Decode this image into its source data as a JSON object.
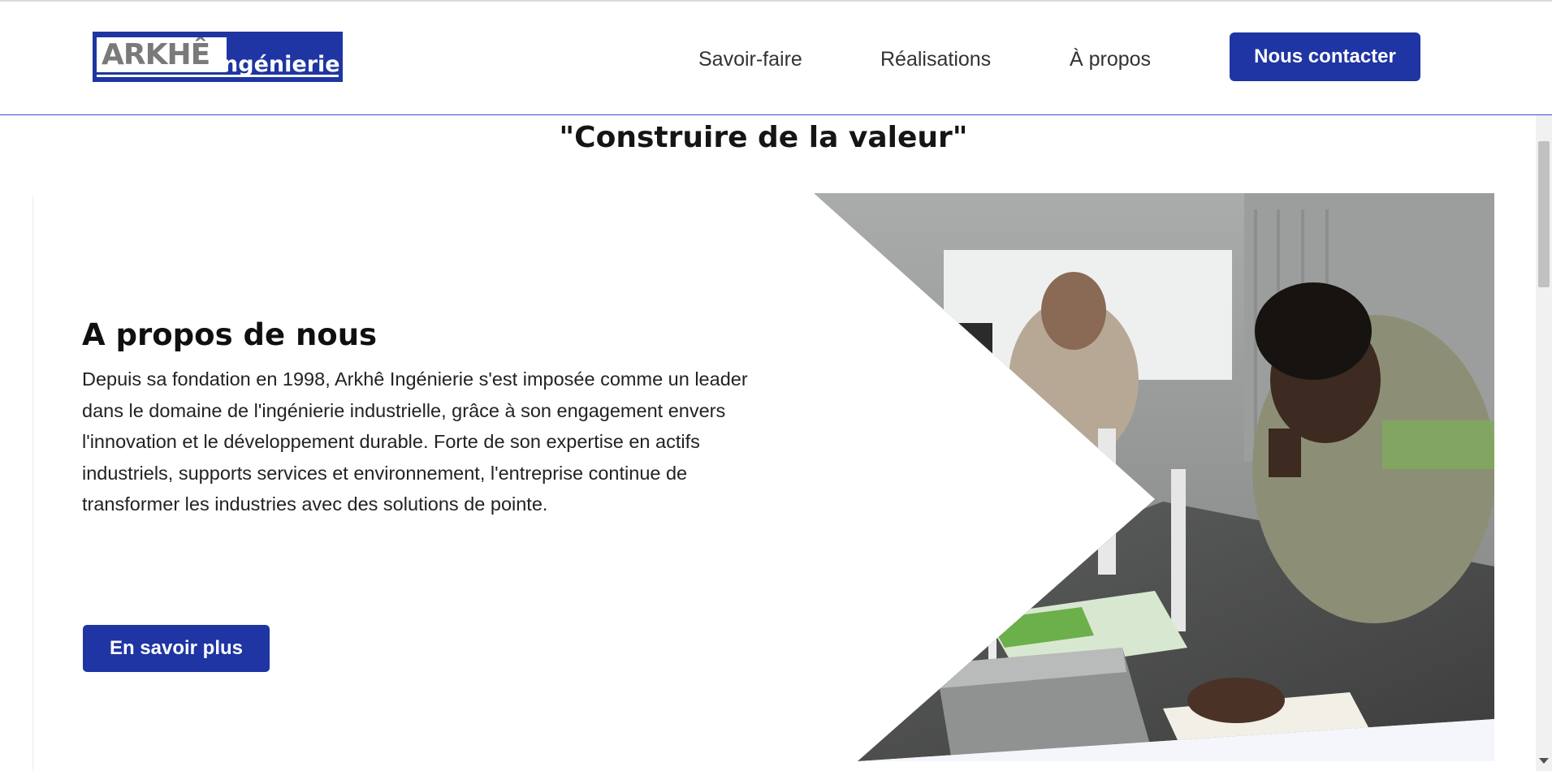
{
  "header": {
    "logo": {
      "word1": "ARKHÊ",
      "word2": "Ingénierie"
    },
    "nav": [
      {
        "label": "Savoir-faire"
      },
      {
        "label": "Réalisations"
      },
      {
        "label": "À propos"
      }
    ],
    "contact_label": "Nous contacter"
  },
  "tagline": "\"Construire de la valeur\"",
  "about": {
    "title": "A propos de nous",
    "text": "Depuis sa fondation en 1998, Arkhê Ingénierie s'est imposée comme un leader dans le domaine de l'ingénierie industrielle, grâce à son engagement envers l'innovation et le développement durable. Forte de son expertise en actifs industriels, supports services et environnement, l'entreprise continue de transformer les industries avec des solutions de pointe.",
    "button_label": "En savoir plus"
  },
  "colors": {
    "brand": "#1f35a3",
    "header_border": "#3b4fd0",
    "text": "#222222"
  }
}
